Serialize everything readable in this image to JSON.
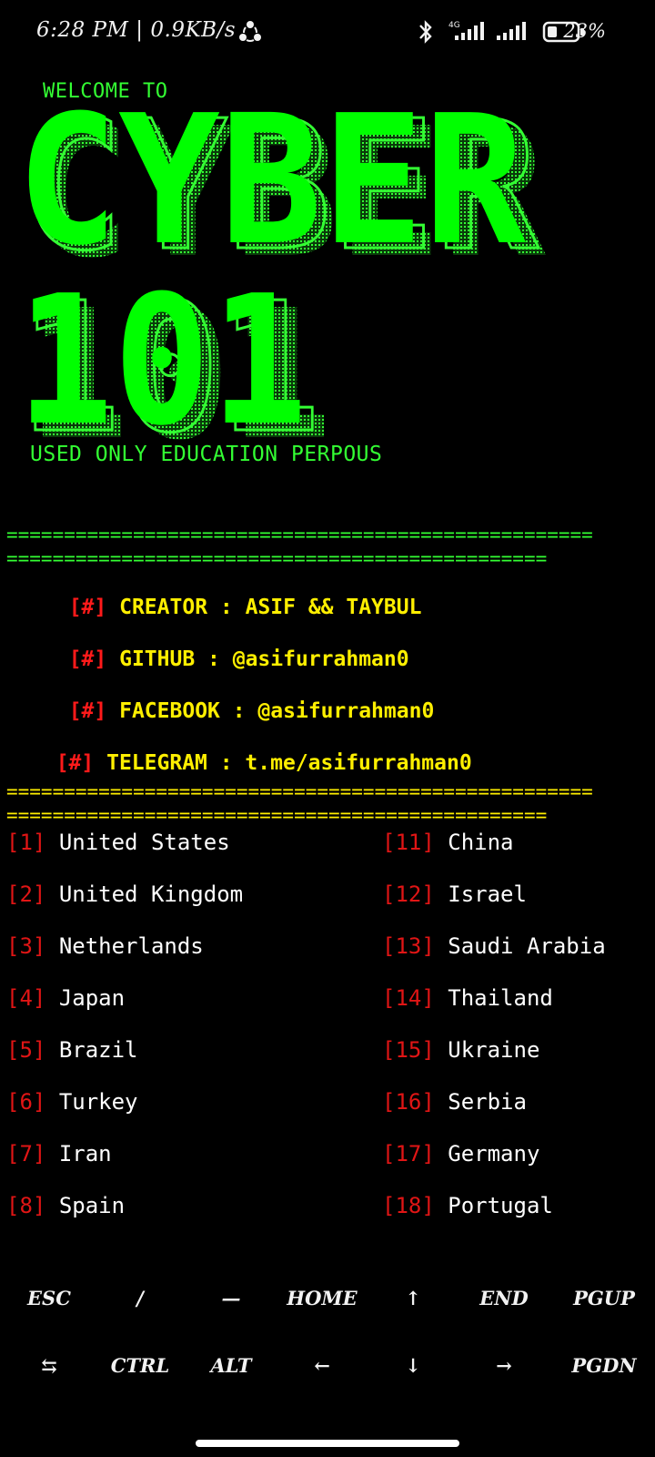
{
  "status_bar": {
    "time": "6:28 PM",
    "speed": "0.9KB/s",
    "battery_pct": "23%",
    "icons": [
      "share-icon",
      "bluetooth-icon",
      "signal-4g-icon",
      "signal-icon",
      "battery-icon"
    ],
    "network_label": "4G"
  },
  "banner": {
    "welcome": "WELCOME TO",
    "line1": "CYBER",
    "line2": "101",
    "tagline": "USED ONLY EDUCATION PERPOUS",
    "accent_color": "#33ff33"
  },
  "separators": {
    "line_long": "===================================================",
    "line_short": "==============================================="
  },
  "info": [
    {
      "tag": "[#]",
      "text": "CREATOR : ASIF && TAYBUL"
    },
    {
      "tag": "[#]",
      "text": "GITHUB : @asifurrahman0"
    },
    {
      "tag": "[#]",
      "text": "FACEBOOK : @asifurrahman0"
    },
    {
      "tag": "[#]",
      "text": "TELEGRAM : t.me/asifurrahman0"
    }
  ],
  "countries_left": [
    {
      "num": "[1]",
      "name": "United States"
    },
    {
      "num": "[2]",
      "name": "United Kingdom"
    },
    {
      "num": "[3]",
      "name": "Netherlands"
    },
    {
      "num": "[4]",
      "name": "Japan"
    },
    {
      "num": "[5]",
      "name": "Brazil"
    },
    {
      "num": "[6]",
      "name": "Turkey"
    },
    {
      "num": "[7]",
      "name": "Iran"
    },
    {
      "num": "[8]",
      "name": "Spain"
    }
  ],
  "countries_right": [
    {
      "num": "[11]",
      "name": "China"
    },
    {
      "num": "[12]",
      "name": "Israel"
    },
    {
      "num": "[13]",
      "name": "Saudi Arabia"
    },
    {
      "num": "[14]",
      "name": "Thailand"
    },
    {
      "num": "[15]",
      "name": "Ukraine"
    },
    {
      "num": "[16]",
      "name": "Serbia"
    },
    {
      "num": "[17]",
      "name": "Germany"
    },
    {
      "num": "[18]",
      "name": "Portugal"
    }
  ],
  "extra_keys": {
    "row1": [
      "ESC",
      "/",
      "—",
      "HOME",
      "↑",
      "END",
      "PGUP"
    ],
    "row2": [
      "⇆",
      "CTRL",
      "ALT",
      "←",
      "↓",
      "→",
      "PGDN"
    ]
  },
  "colors": {
    "background": "#000000",
    "info_tag": "#ff1a1a",
    "info_text": "#ffef00",
    "country_num": "#e01515",
    "country_name": "#ffffff"
  }
}
